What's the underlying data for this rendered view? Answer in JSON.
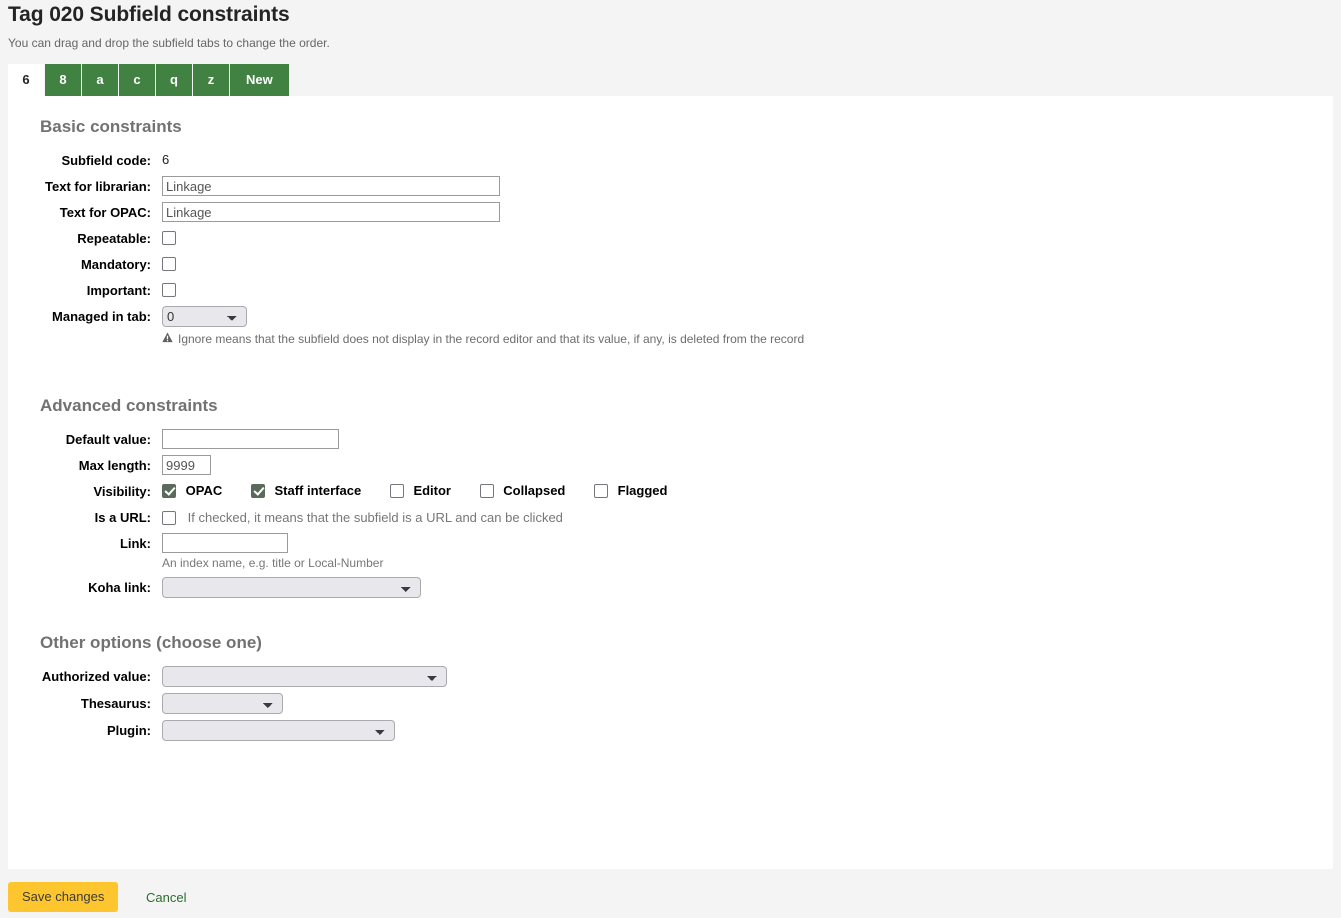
{
  "header": {
    "title": "Tag 020 Subfield constraints",
    "hint": "You can drag and drop the subfield tabs to change the order."
  },
  "tabs": [
    {
      "label": "6",
      "active": true
    },
    {
      "label": "8",
      "active": false
    },
    {
      "label": "a",
      "active": false
    },
    {
      "label": "c",
      "active": false
    },
    {
      "label": "q",
      "active": false
    },
    {
      "label": "z",
      "active": false
    },
    {
      "label": "New",
      "active": false
    }
  ],
  "sections": {
    "basic": {
      "title": "Basic constraints",
      "subfield_code_label": "Subfield code:",
      "subfield_code_value": "6",
      "text_librarian_label": "Text for librarian:",
      "text_librarian_value": "Linkage",
      "text_opac_label": "Text for OPAC:",
      "text_opac_value": "Linkage",
      "repeatable_label": "Repeatable:",
      "repeatable_checked": false,
      "mandatory_label": "Mandatory:",
      "mandatory_checked": false,
      "important_label": "Important:",
      "important_checked": false,
      "managed_tab_label": "Managed in tab:",
      "managed_tab_value": "0",
      "managed_tab_options": [
        "0"
      ],
      "warning_icon": "warning-triangle-icon",
      "warning_text": "Ignore means that the subfield does not display in the record editor and that its value, if any, is deleted from the record"
    },
    "advanced": {
      "title": "Advanced constraints",
      "default_value_label": "Default value:",
      "default_value": "",
      "max_length_label": "Max length:",
      "max_length_value": "9999",
      "visibility_label": "Visibility:",
      "visibility": [
        {
          "label": "OPAC",
          "checked": true
        },
        {
          "label": "Staff interface",
          "checked": true
        },
        {
          "label": "Editor",
          "checked": false
        },
        {
          "label": "Collapsed",
          "checked": false
        },
        {
          "label": "Flagged",
          "checked": false
        }
      ],
      "is_url_label": "Is a URL:",
      "is_url_checked": false,
      "is_url_hint": "If checked, it means that the subfield is a URL and can be clicked",
      "link_label": "Link:",
      "link_value": "",
      "link_help": "An index name, e.g. title or Local-Number",
      "koha_link_label": "Koha link:",
      "koha_link_value": "",
      "koha_link_options": [
        ""
      ]
    },
    "other": {
      "title": "Other options (choose one)",
      "authorized_value_label": "Authorized value:",
      "authorized_value": "",
      "authorized_value_options": [
        ""
      ],
      "thesaurus_label": "Thesaurus:",
      "thesaurus_value": "",
      "thesaurus_options": [
        ""
      ],
      "plugin_label": "Plugin:",
      "plugin_value": "",
      "plugin_options": [
        ""
      ]
    }
  },
  "footer": {
    "save_label": "Save changes",
    "cancel_label": "Cancel"
  },
  "colors": {
    "tab_green": "#418142",
    "save_yellow": "#fdc62e",
    "cancel_green": "#2b6e2e",
    "checkbox_checked": "#5b6b5b",
    "page_background": "#f4f4f4",
    "panel_background": "#ffffff"
  }
}
